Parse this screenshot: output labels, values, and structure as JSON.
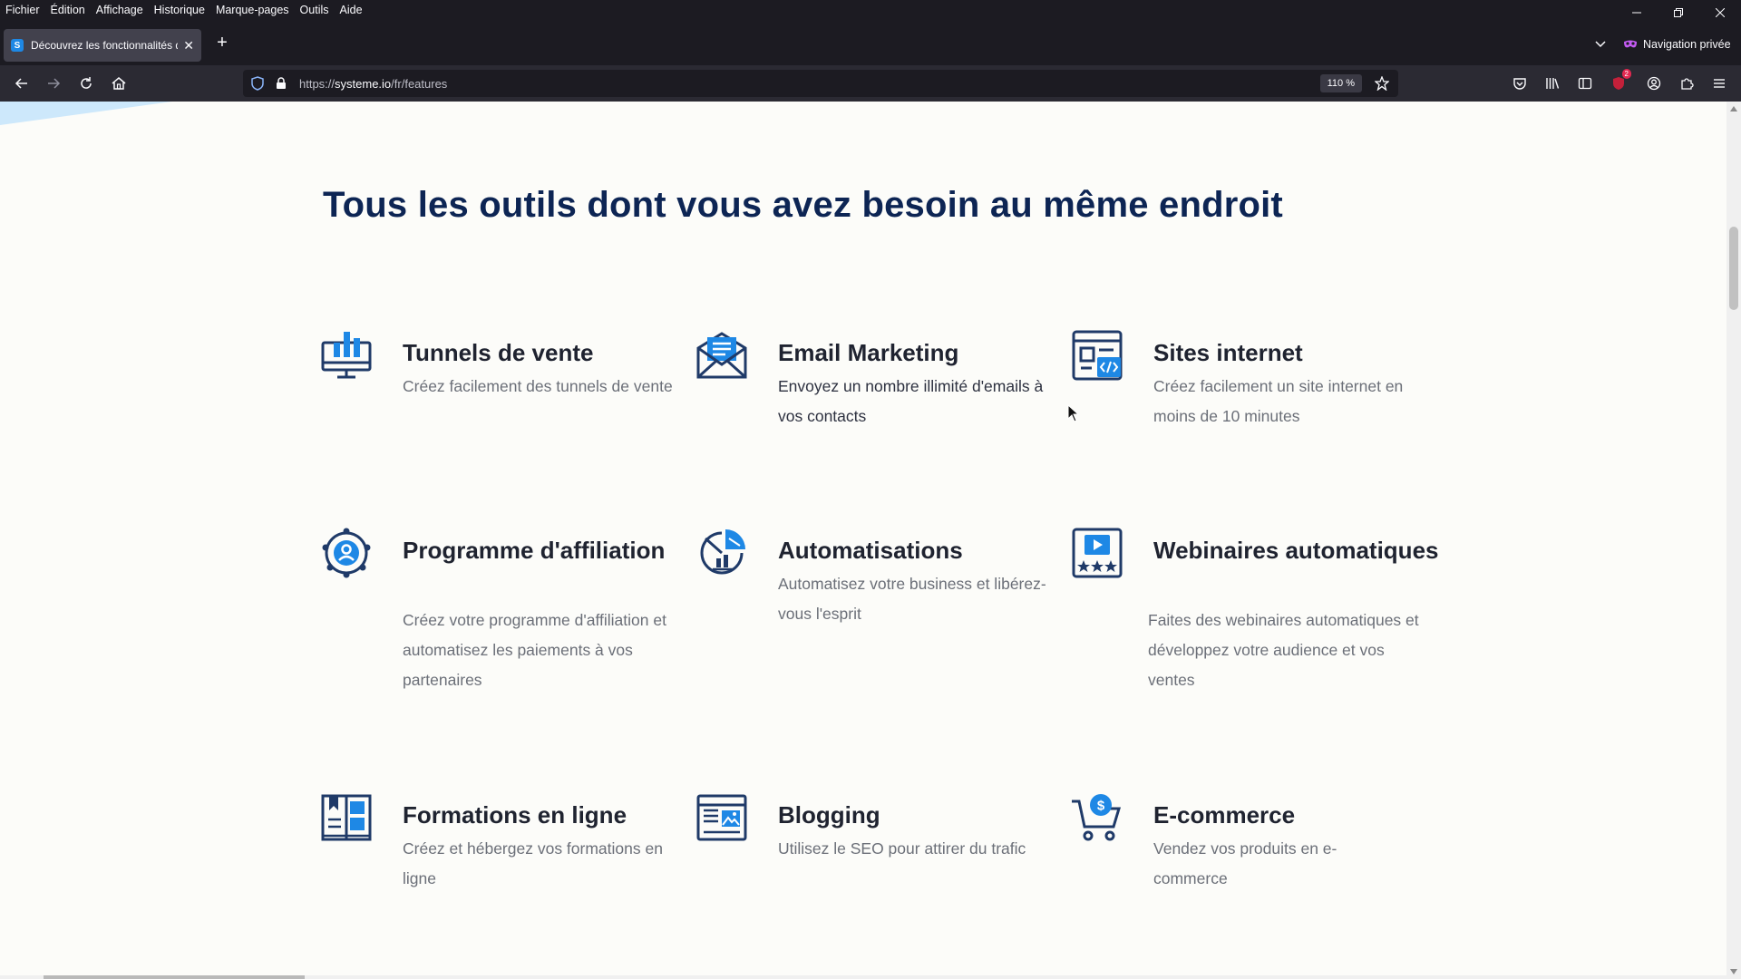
{
  "menubar": [
    "Fichier",
    "Édition",
    "Affichage",
    "Historique",
    "Marque-pages",
    "Outils",
    "Aide"
  ],
  "tab": {
    "favicon_letter": "S",
    "title": "Découvrez les fonctionnalités d"
  },
  "private_label": "Navigation privée",
  "url": {
    "prefix": "https://",
    "domain": "systeme.io",
    "path": "/fr/features"
  },
  "zoom": "110 %",
  "ext_badge": "2",
  "page": {
    "headline": "Tous les outils dont vous avez besoin au même endroit",
    "features": [
      {
        "title": "Tunnels de vente",
        "desc": "Créez facilement des tunnels de vente",
        "icon": "sales-funnel-icon"
      },
      {
        "title": "Email Marketing",
        "desc": "Envoyez un nombre illimité d'emails à vos contacts",
        "icon": "email-icon"
      },
      {
        "title": "Sites internet",
        "desc": "Créez facilement un site internet en moins de 10 minutes",
        "icon": "website-icon"
      },
      {
        "title": "Programme d'affiliation",
        "desc": "Créez votre programme d'affiliation et automatisez les paiements à vos partenaires",
        "icon": "affiliate-icon"
      },
      {
        "title": "Automatisations",
        "desc": "Automatisez votre business et libérez-vous l'esprit",
        "icon": "automation-icon"
      },
      {
        "title": "Webinaires automatiques",
        "desc": "Faites des webinaires automatiques et développez votre audience et vos ventes",
        "icon": "webinar-icon"
      },
      {
        "title": "Formations en ligne",
        "desc": "Créez et hébergez vos formations en ligne",
        "icon": "course-book-icon"
      },
      {
        "title": "Blogging",
        "desc": "Utilisez le SEO pour attirer du trafic",
        "icon": "blog-icon"
      },
      {
        "title": "E-commerce",
        "desc": "Vendez vos produits en e-commerce",
        "icon": "shopping-cart-icon"
      }
    ]
  },
  "colors": {
    "brand_blue": "#1e88e5",
    "navy": "#0d2554",
    "icon_navy": "#1f3a68"
  }
}
